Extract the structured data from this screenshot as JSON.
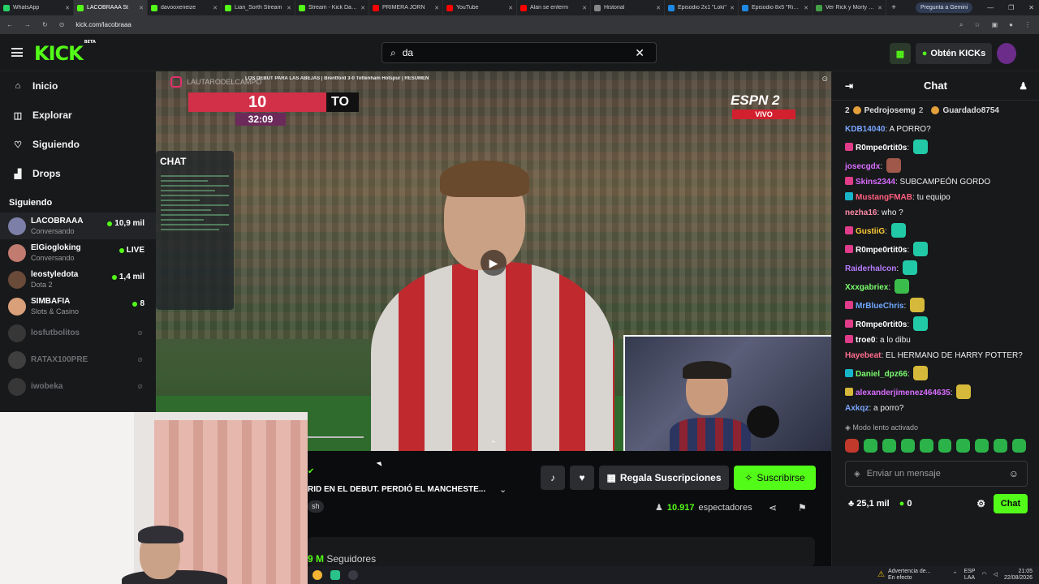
{
  "browser": {
    "tabs": [
      {
        "label": "WhatsApp",
        "color": "#25d366"
      },
      {
        "label": "LACOBRAAA St",
        "color": "#53fc18",
        "active": true
      },
      {
        "label": "davooxeneize",
        "color": "#53fc18"
      },
      {
        "label": "Lian_Sorth Stream",
        "color": "#53fc18"
      },
      {
        "label": "Stream - Kick Dash",
        "color": "#53fc18"
      },
      {
        "label": "PRIMERA JORN",
        "color": "#ff0000"
      },
      {
        "label": "YouTube",
        "color": "#ff0000"
      },
      {
        "label": "Alan se enferm",
        "color": "#ff0000"
      },
      {
        "label": "Historial",
        "color": "#888888"
      },
      {
        "label": "Episodio 2x1 \"Loki\"",
        "color": "#1e88e5"
      },
      {
        "label": "Episodio 8x5 \"Rick y",
        "color": "#1e88e5"
      },
      {
        "label": "Ver Rick y Morty 8x",
        "color": "#43a047"
      }
    ],
    "gemini_label": "Pregunta a Gemini",
    "url": "kick.com/lacobraaa"
  },
  "header": {
    "logo": "KICK",
    "logo_badge": "BETA",
    "search_value": "da",
    "cta_label": "Obtén KICKs"
  },
  "sidebar": {
    "nav": [
      {
        "label": "Inicio",
        "icon": "home-icon"
      },
      {
        "label": "Explorar",
        "icon": "compass-icon"
      },
      {
        "label": "Siguiendo",
        "icon": "heart-icon"
      },
      {
        "label": "Drops",
        "icon": "gift-icon"
      }
    ],
    "following_title": "Siguiendo",
    "channels": [
      {
        "name": "LACOBRAAA",
        "sub": "Conversando",
        "viewers": "10,9 mil",
        "live": true,
        "color": "#7c7fa8"
      },
      {
        "name": "ElGiogloking",
        "sub": "Conversando",
        "viewers": "LIVE",
        "live": true,
        "color": "#c27b6f"
      },
      {
        "name": "leostyledota",
        "sub": "Dota 2",
        "viewers": "1,4 mil",
        "live": true,
        "color": "#6a4a38"
      },
      {
        "name": "SIMBAFIA",
        "sub": "Slots & Casino",
        "viewers": "8",
        "live": true,
        "color": "#d9a07a"
      },
      {
        "name": "losfutbolitos",
        "sub": "",
        "viewers": "",
        "live": false,
        "color": "#555"
      },
      {
        "name": "RATAX100PRE",
        "sub": "",
        "viewers": "",
        "live": false,
        "color": "#666"
      },
      {
        "name": "iwobeka",
        "sub": "",
        "viewers": "",
        "live": false,
        "color": "#555"
      }
    ]
  },
  "video": {
    "overlay_title": "LOS DEBUT PARA LAS ABEJAS | Brentford 3-0 Tottenham Hotspur | RESUMEN",
    "handle": "LAUTARODELCAMPO",
    "score_left": "10",
    "score_right": "TO",
    "clock": "32:09",
    "network": "ESPN 2",
    "network_live": "VIVO",
    "mini_chat_label": "CHAT"
  },
  "stream": {
    "title": "RID EN EL DEBUT. PERDIÓ EL MANCHESTE...",
    "tag": "sh",
    "gift_label": "Regala Suscripciones",
    "subscribe_label": "Suscribirse",
    "viewers_count": "10.917",
    "viewers_label": "espectadores",
    "followers_count": "9 M",
    "followers_label": "Seguidores"
  },
  "chat": {
    "title": "Chat",
    "gifters": [
      {
        "rank": "2",
        "name": "Pedrojosemg",
        "count": "2"
      },
      {
        "rank": "",
        "name": "Guardado8754",
        "count": ""
      }
    ],
    "messages": [
      {
        "user": "KDB14040",
        "color": "#7aa6ff",
        "text": "A PORRO?",
        "badge": "",
        "emote": ""
      },
      {
        "user": "R0mpe0rtit0s",
        "color": "#ffffff",
        "text": "",
        "badge": "#e03c8a",
        "emote": "#21c9a7"
      },
      {
        "user": "josecgdx",
        "color": "#d86dff",
        "text": "",
        "badge": "",
        "emote": "#a0584a"
      },
      {
        "user": "Skins2344",
        "color": "#d86dff",
        "text": "SUBCAMPEÓN GORDO",
        "badge": "#e03c8a",
        "emote": ""
      },
      {
        "user": "MustangFMAB",
        "color": "#ff5e7e",
        "text": "tu equipo",
        "badge": "#18b5c9",
        "emote": ""
      },
      {
        "user": "nezha16",
        "color": "#ff8aa8",
        "text": "who ?",
        "badge": "",
        "emote": ""
      },
      {
        "user": "GustiiG",
        "color": "#ffcc33",
        "text": "",
        "badge": "#e03c8a",
        "emote": "#21c9a7"
      },
      {
        "user": "R0mpe0rtit0s",
        "color": "#ffffff",
        "text": "",
        "badge": "#e03c8a",
        "emote": "#21c9a7"
      },
      {
        "user": "Raiderhalcon",
        "color": "#b77cff",
        "text": "",
        "badge": "",
        "emote": "#21c9a7"
      },
      {
        "user": "Xxxgabriex",
        "color": "#7bff6e",
        "text": "",
        "badge": "",
        "emote": "#3bbd4c"
      },
      {
        "user": "MrBlueChris",
        "color": "#6fa8ff",
        "text": "",
        "badge": "#e03c8a",
        "emote": "#d6b93a"
      },
      {
        "user": "R0mpe0rtit0s",
        "color": "#ffffff",
        "text": "",
        "badge": "#e03c8a",
        "emote": "#21c9a7"
      },
      {
        "user": "troe0",
        "color": "#ffffff",
        "text": "a lo dibu",
        "badge": "#e03c8a",
        "emote": ""
      },
      {
        "user": "Hayebeat",
        "color": "#ff6e8e",
        "text": "EL HERMANO DE HARRY POTTER?",
        "badge": "",
        "emote": ""
      },
      {
        "user": "Daniel_dpz66",
        "color": "#7bff6e",
        "text": "",
        "badge": "#18b5c9",
        "emote": "#d6b93a"
      },
      {
        "user": "alexanderjimenez464635",
        "color": "#d86dff",
        "text": "",
        "badge": "#d6b93a",
        "emote": "#d6b93a"
      },
      {
        "user": "Axkqz",
        "color": "#7aa6ff",
        "text": "a porro?",
        "badge": "",
        "emote": ""
      }
    ],
    "slow_mode": "Modo lento activado",
    "input_placeholder": "Enviar un mensaje",
    "kicks_balance": "25,1 mil",
    "points": "0",
    "send_label": "Chat"
  },
  "taskbar": {
    "alert_title": "Advertencia de...",
    "alert_sub": "En efecto",
    "lang": "ESP",
    "region": "LAA",
    "time": "21:05",
    "date": "22/08/2026"
  }
}
